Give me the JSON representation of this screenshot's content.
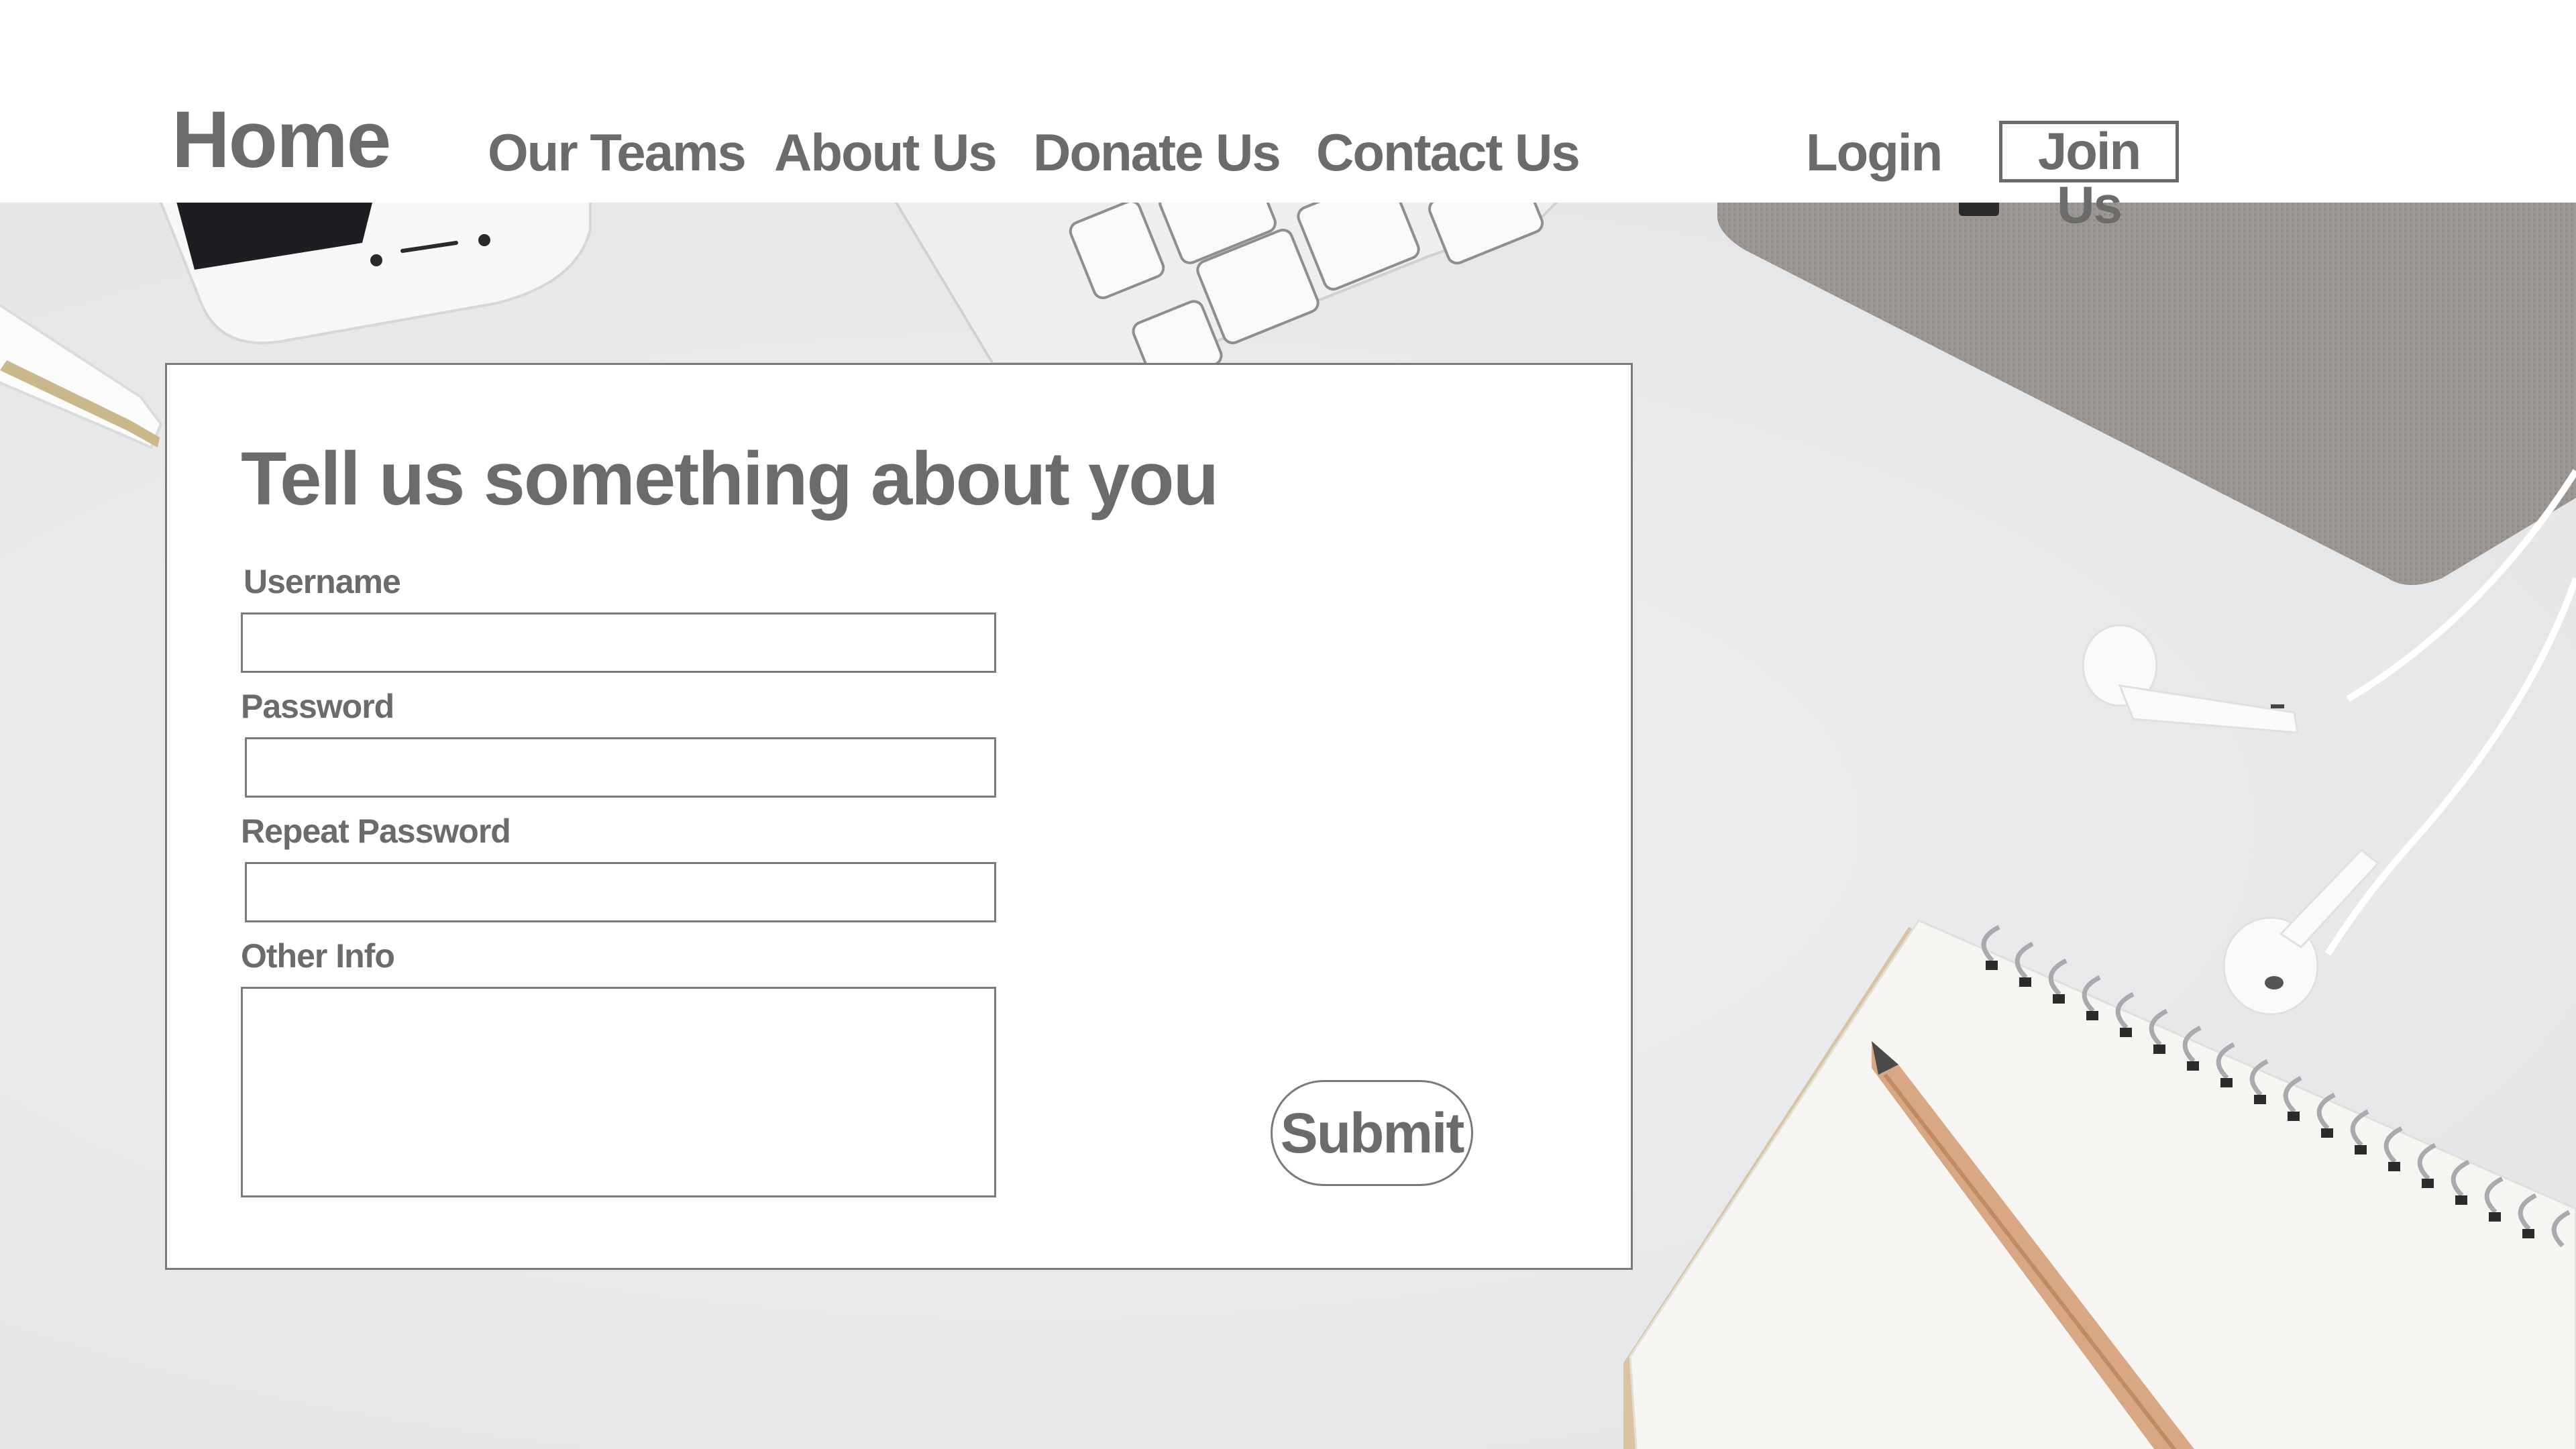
{
  "nav": {
    "brand": "Home",
    "links": [
      "Our Teams",
      "About Us",
      "Donate Us",
      "Contact Us"
    ],
    "login": "Login",
    "join": "Join Us"
  },
  "form": {
    "title": "Tell us something about you",
    "username_label": "Username",
    "username_value": "",
    "password_label": "Password",
    "password_value": "",
    "repeat_password_label": "Repeat Password",
    "repeat_password_value": "",
    "other_info_label": "Other Info",
    "other_info_value": "",
    "submit_label": "Submit"
  },
  "colors": {
    "text": "#6b6b6b",
    "border": "#7a7a7a",
    "background": "#e6e7e9",
    "header_background": "#ffffff"
  }
}
